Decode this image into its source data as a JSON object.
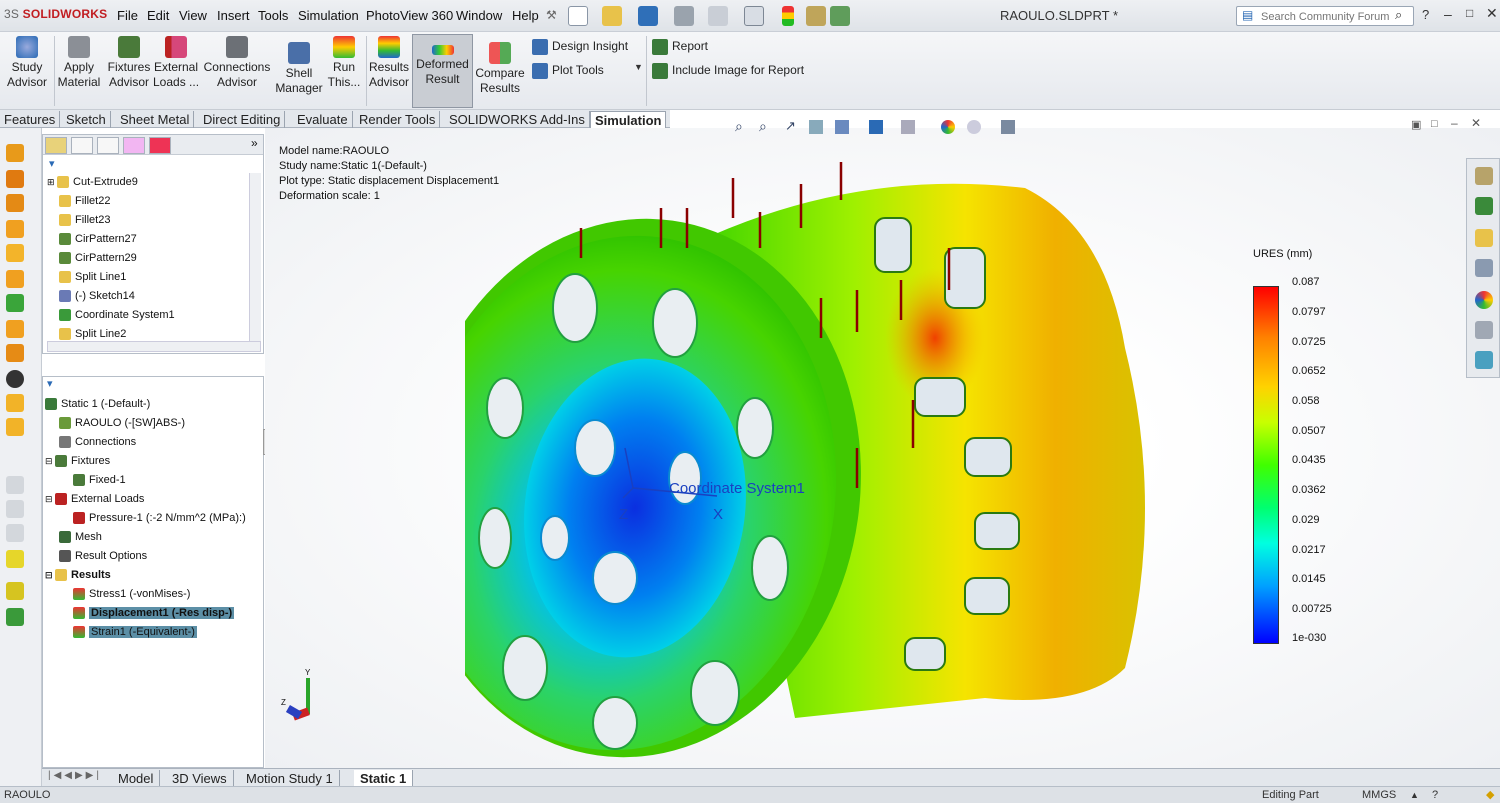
{
  "app": {
    "brand": "SOLIDWORKS",
    "doc_title": "RAOULO.SLDPRT *"
  },
  "menu": [
    "File",
    "Edit",
    "View",
    "Insert",
    "Tools",
    "Simulation",
    "PhotoView 360",
    "Window",
    "Help"
  ],
  "search": {
    "placeholder": "Search Community Forum"
  },
  "ribbon": {
    "study_advisor": "Study\nAdvisor",
    "apply_material": "Apply\nMaterial",
    "fixtures_advisor": "Fixtures\nAdvisor",
    "external_loads": "External\nLoads ...",
    "connections_advisor": "Connections\nAdvisor",
    "shell_manager": "Shell\nManager",
    "run_this": "Run\nThis...",
    "results_advisor": "Results\nAdvisor",
    "deformed_result": "Deformed\nResult",
    "compare_results": "Compare\nResults",
    "design_insight": "Design Insight",
    "plot_tools": "Plot Tools",
    "report": "Report",
    "include_image": "Include Image for Report"
  },
  "tabs": [
    "Features",
    "Sketch",
    "Sheet Metal",
    "Direct Editing",
    "Evaluate",
    "Render Tools",
    "SOLIDWORKS Add-Ins",
    "Simulation"
  ],
  "feature_tree": [
    "Cut-Extrude9",
    "Fillet22",
    "Fillet23",
    "CirPattern27",
    "CirPattern29",
    "Split Line1",
    "(-) Sketch14",
    "Coordinate System1",
    "Split Line2"
  ],
  "study_tree": {
    "study": "Static 1 (-Default-)",
    "part": "RAOULO (-[SW]ABS-)",
    "connections": "Connections",
    "fixtures": "Fixtures",
    "fixed": "Fixed-1",
    "external_loads": "External Loads",
    "pressure": "Pressure-1 (:-2 N/mm^2 (MPa):)",
    "mesh": "Mesh",
    "result_options": "Result Options",
    "results": "Results",
    "stress": "Stress1 (-vonMises-)",
    "displacement": "Displacement1 (-Res disp-)",
    "strain": "Strain1 (-Equivalent-)"
  },
  "plot_info": {
    "model": "Model name:RAOULO",
    "study": "Study name:Static 1(-Default-)",
    "type": "Plot type: Static displacement Displacement1",
    "scale": "Deformation scale: 1"
  },
  "legend": {
    "title": "URES (mm)",
    "ticks": [
      "0.087",
      "0.0797",
      "0.0725",
      "0.0652",
      "0.058",
      "0.0507",
      "0.0435",
      "0.0362",
      "0.029",
      "0.0217",
      "0.0145",
      "0.00725",
      "1e-030"
    ]
  },
  "coord_label": "Coordinate System1",
  "axis_labels": {
    "x": "X",
    "y": "Y",
    "z": "Z"
  },
  "bottom_tabs": [
    "Model",
    "3D Views",
    "Motion Study 1",
    "Static 1"
  ],
  "status": {
    "left": "RAOULO",
    "mode": "Editing Part",
    "units": "MMGS"
  },
  "colors": {
    "accent": "#c11d21",
    "selection": "#5c8fa6"
  }
}
